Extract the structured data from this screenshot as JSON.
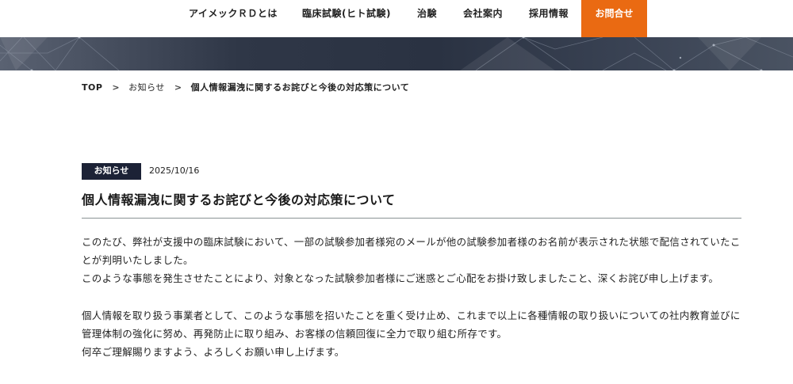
{
  "nav": {
    "items": [
      "アイメックＲＤとは",
      "臨床試験(ヒト試験)",
      "治験",
      "会社案内",
      "採用情報"
    ],
    "contact_label": "お問合せ"
  },
  "breadcrumb": {
    "home": "TOP",
    "category": "お知らせ",
    "current": "個人情報漏洩に関するお詫びと今後の対応策について"
  },
  "post": {
    "category": "お知らせ",
    "date": "2025/10/16",
    "title": "個人情報漏洩に関するお詫びと今後の対応策について",
    "paragraph1": [
      "このたび、弊社が支援中の臨床試験において、一部の試験参加者様宛のメールが他の試験参加者様のお名前が表示された状態で配信されていたことが判明いたしました。",
      "このような事態を発生させたことにより、対象となった試験参加者様にご迷惑とご心配をお掛け致しましたこと、深くお詫び申し上げます。"
    ],
    "paragraph2": [
      "個人情報を取り扱う事業者として、このような事態を招いたことを重く受け止め、これまで以上に各種情報の取り扱いについての社内教育並びに管理体制の強化に努め、再発防止に取り組み、お客様の信頼回復に全力で取り組む所存です。",
      "何卒ご理解賜りますよう、よろしくお願い申し上げます。"
    ]
  },
  "colors": {
    "accent": "#ea6a12",
    "badge": "#1c2236"
  }
}
